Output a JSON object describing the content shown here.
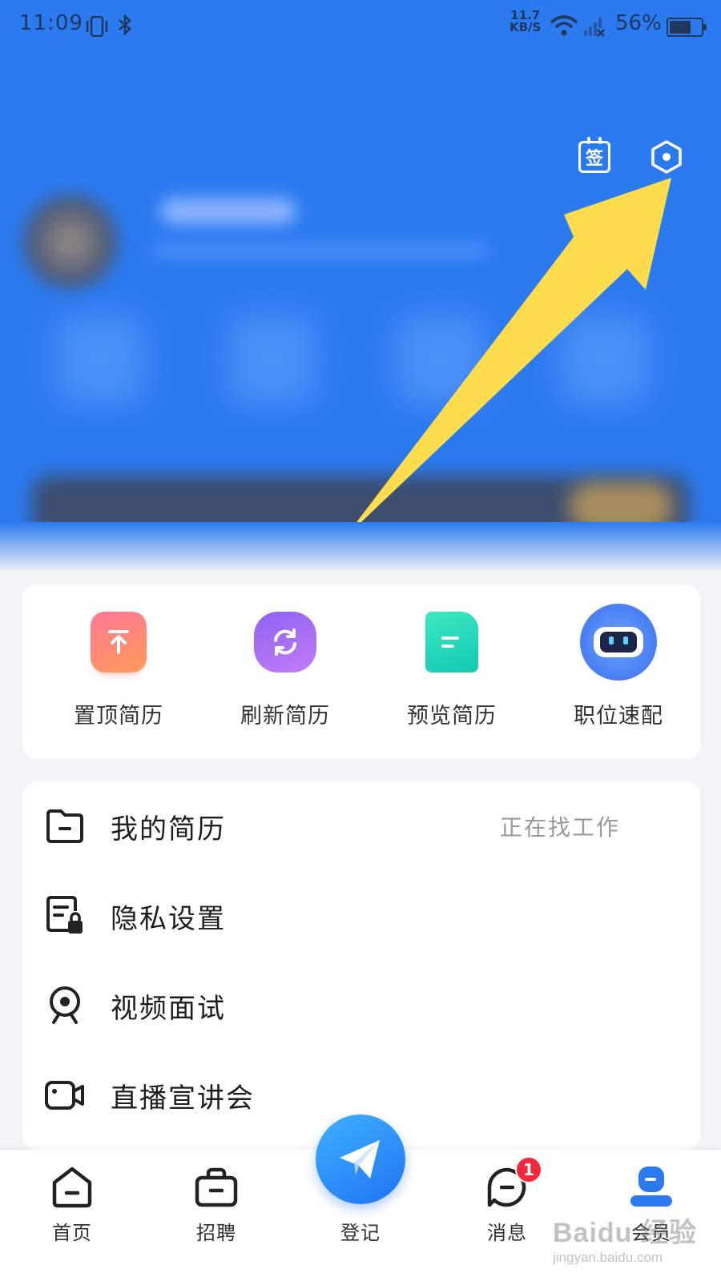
{
  "status_bar": {
    "time": "11:09",
    "net_speed_value": "11.7",
    "net_speed_unit": "KB/S",
    "battery": "56%"
  },
  "header": {
    "sign_icon_text": "签"
  },
  "quick_tools": [
    {
      "label": "置顶简历",
      "icon": "arrow-up-icon"
    },
    {
      "label": "刷新简历",
      "icon": "refresh-icon"
    },
    {
      "label": "预览简历",
      "icon": "document-icon"
    },
    {
      "label": "职位速配",
      "icon": "robot-icon"
    }
  ],
  "menu": [
    {
      "label": "我的简历",
      "value": "正在找工作",
      "icon": "folder-icon"
    },
    {
      "label": "隐私设置",
      "value": "",
      "icon": "privacy-lock-icon"
    },
    {
      "label": "视频面试",
      "value": "",
      "icon": "camera-icon"
    },
    {
      "label": "直播宣讲会",
      "value": "",
      "icon": "video-icon"
    }
  ],
  "bottom_nav": [
    {
      "label": "首页",
      "icon": "home-icon"
    },
    {
      "label": "招聘",
      "icon": "briefcase-icon"
    },
    {
      "label": "登记",
      "icon": "paper-plane-icon"
    },
    {
      "label": "消息",
      "icon": "message-icon",
      "badge": "1"
    },
    {
      "label": "会员",
      "icon": "member-icon",
      "active": true
    }
  ],
  "watermark": {
    "logo": "Baidu 经验",
    "url": "jingyan.baidu.com"
  },
  "colors": {
    "header_blue": "#2b7af0",
    "annotation_arrow": "#fddc4d",
    "badge_red": "#f4283c"
  }
}
